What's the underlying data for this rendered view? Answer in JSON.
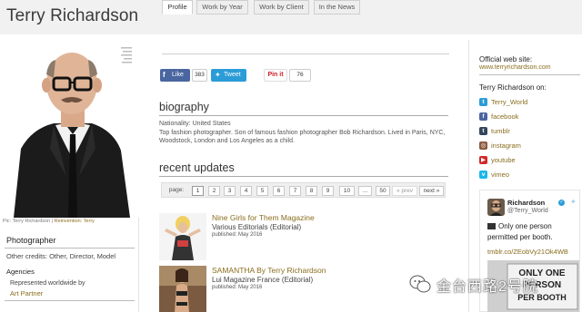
{
  "header": {
    "title": "Terry Richardson"
  },
  "left": {
    "photo_credit_prefix": "Pic: Terry Richardson",
    "photo_credit_link": "Reinvention: Terry",
    "profession": "Photographer",
    "other_credits": "Other credits: Other, Director, Model",
    "agencies_label": "Agencies",
    "represented": "Represented worldwide by",
    "agency_name": "Art Partner",
    "photo_note_lines": [
      "—— ——",
      "—— —",
      "——",
      "— ——",
      "——"
    ]
  },
  "tabs": [
    {
      "label": "Profile",
      "active": true
    },
    {
      "label": "Work by Year",
      "active": false
    },
    {
      "label": "Work by Client",
      "active": false
    },
    {
      "label": "In the News",
      "active": false
    }
  ],
  "share": {
    "fb_label": "Like",
    "fb_count": "383",
    "tw_label": "Tweet",
    "pin_label": "Pin it",
    "pin_count": "76"
  },
  "biography": {
    "heading": "biography",
    "nationality": "Nationality: United States",
    "text": "Top fashion photographer. Son of famous fashion photographer Bob Richardson. Lived in Paris, NYC, Woodstock, London and Los Angeles as a child."
  },
  "updates": {
    "heading": "recent updates",
    "pager": {
      "label": "page:",
      "pages": [
        "1",
        "2",
        "3",
        "4",
        "5",
        "6",
        "7",
        "8",
        "9",
        "10",
        "...",
        "50"
      ],
      "prev": "« prev",
      "next": "next »"
    },
    "items": [
      {
        "title": "Nine Girls for Them Magazine",
        "subtitle": "Various Editorials (Editorial)",
        "date": "published: May 2016"
      },
      {
        "title": "SAMANTHA By Terry Richardson",
        "subtitle": "Lui Magazine France (Editorial)",
        "date": "published: May 2016"
      }
    ]
  },
  "right": {
    "official_title": "Official web site:",
    "official_link": "www.terryrichardson.com",
    "on_title": "Terry Richardson on:",
    "social": [
      {
        "label": "Terry_World",
        "icon": "twitter-icon",
        "color": "#2b9cd8",
        "glyph": "t"
      },
      {
        "label": "facebook",
        "icon": "facebook-icon",
        "color": "#4a66a0",
        "glyph": "f"
      },
      {
        "label": "tumblr",
        "icon": "tumblr-icon",
        "color": "#35465c",
        "glyph": "t"
      },
      {
        "label": "instagram",
        "icon": "instagram-icon",
        "color": "#8a5a3c",
        "glyph": "◎"
      },
      {
        "label": "youtube",
        "icon": "youtube-icon",
        "color": "#d12a2a",
        "glyph": "▶"
      },
      {
        "label": "vimeo",
        "icon": "vimeo-icon",
        "color": "#1ab7ea",
        "glyph": "v"
      }
    ],
    "tweet": {
      "name": "Richardson",
      "handle": "@Terry_World",
      "text": "Only one person permitted per booth.",
      "link": "tmblr.co/ZEobVy21Ok4WB",
      "image_lines": [
        "ONLY ONE",
        "PERSON",
        "PER BOOTH"
      ]
    }
  },
  "watermark": {
    "text": "金台西路2号院"
  },
  "colors": {
    "link": "#8a6d1d",
    "header_band": "#f1f1f1",
    "facebook": "#4a66a0",
    "twitter": "#2b9cd8",
    "pinterest": "#cb2027"
  }
}
